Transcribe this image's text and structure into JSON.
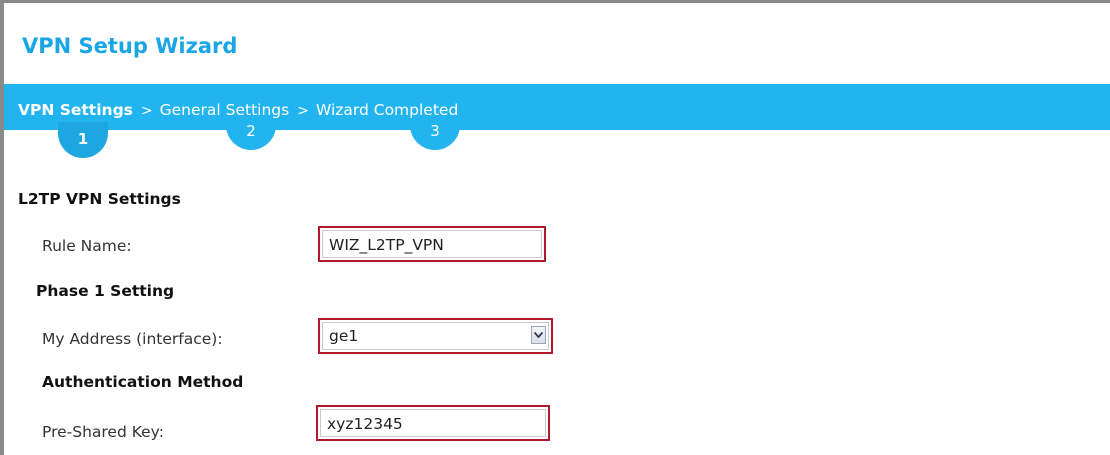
{
  "window": {
    "title": "VPN Setup Wizard"
  },
  "steps": {
    "items": [
      {
        "label": "VPN Settings",
        "number": "1",
        "active": true
      },
      {
        "label": "General Settings",
        "number": "2",
        "active": false
      },
      {
        "label": "Wizard Completed",
        "number": "3",
        "active": false
      }
    ],
    "separator": ">"
  },
  "form": {
    "section_title": "L2TP VPN Settings",
    "rule_name": {
      "label": "Rule Name:",
      "value": "WIZ_L2TP_VPN"
    },
    "phase1": {
      "title": "Phase 1 Setting",
      "my_address": {
        "label": "My Address (interface):",
        "value": "ge1",
        "icon": "chevron-down-icon"
      }
    },
    "auth": {
      "title": "Authentication Method",
      "psk": {
        "label": "Pre-Shared Key:",
        "value": "xyz12345"
      }
    }
  },
  "colors": {
    "accent": "#22b4ee",
    "title": "#1aa6e4",
    "highlight_border": "#b3192c"
  }
}
